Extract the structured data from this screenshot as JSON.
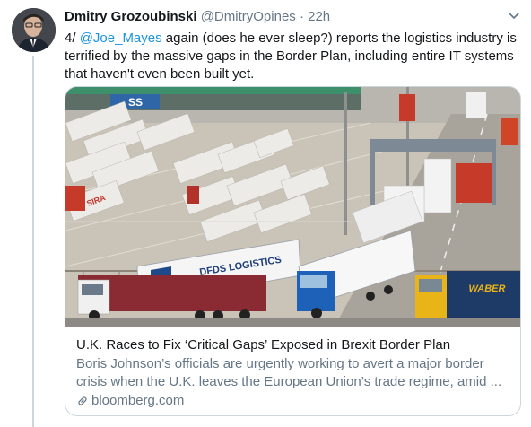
{
  "tweet": {
    "author_name": "Dmitry Grozoubinski",
    "author_handle": "@DmitryOpines",
    "separator": "·",
    "timestamp": "22h",
    "text_prefix": "4/ ",
    "mention": "@Joe_Mayes",
    "text_body": " again (does he ever sleep?) reports the logistics industry is terrified by the massive gaps in the Border Plan, including entire IT systems that haven't even been built yet."
  },
  "card": {
    "title": "U.K. Races to Fix ‘Critical Gaps’ Exposed in Brexit Border Plan",
    "description": "Boris Johnson’s officials are urgently working to avert a major border crisis when the U.K. leaves the European Union’s trade regime, amid ...",
    "domain": "bloomberg.com",
    "image_texts": {
      "truck_side": "DFDS LOGISTICS",
      "trailer_brand": "SIRA",
      "right_truck_brand": "WABER",
      "building_sign": "SS"
    }
  },
  "icons": {
    "caret": "chevron-down-icon",
    "link": "link-icon"
  },
  "colors": {
    "link": "#1b95e0",
    "secondary_text": "#657786",
    "border": "#ccd6dd"
  }
}
